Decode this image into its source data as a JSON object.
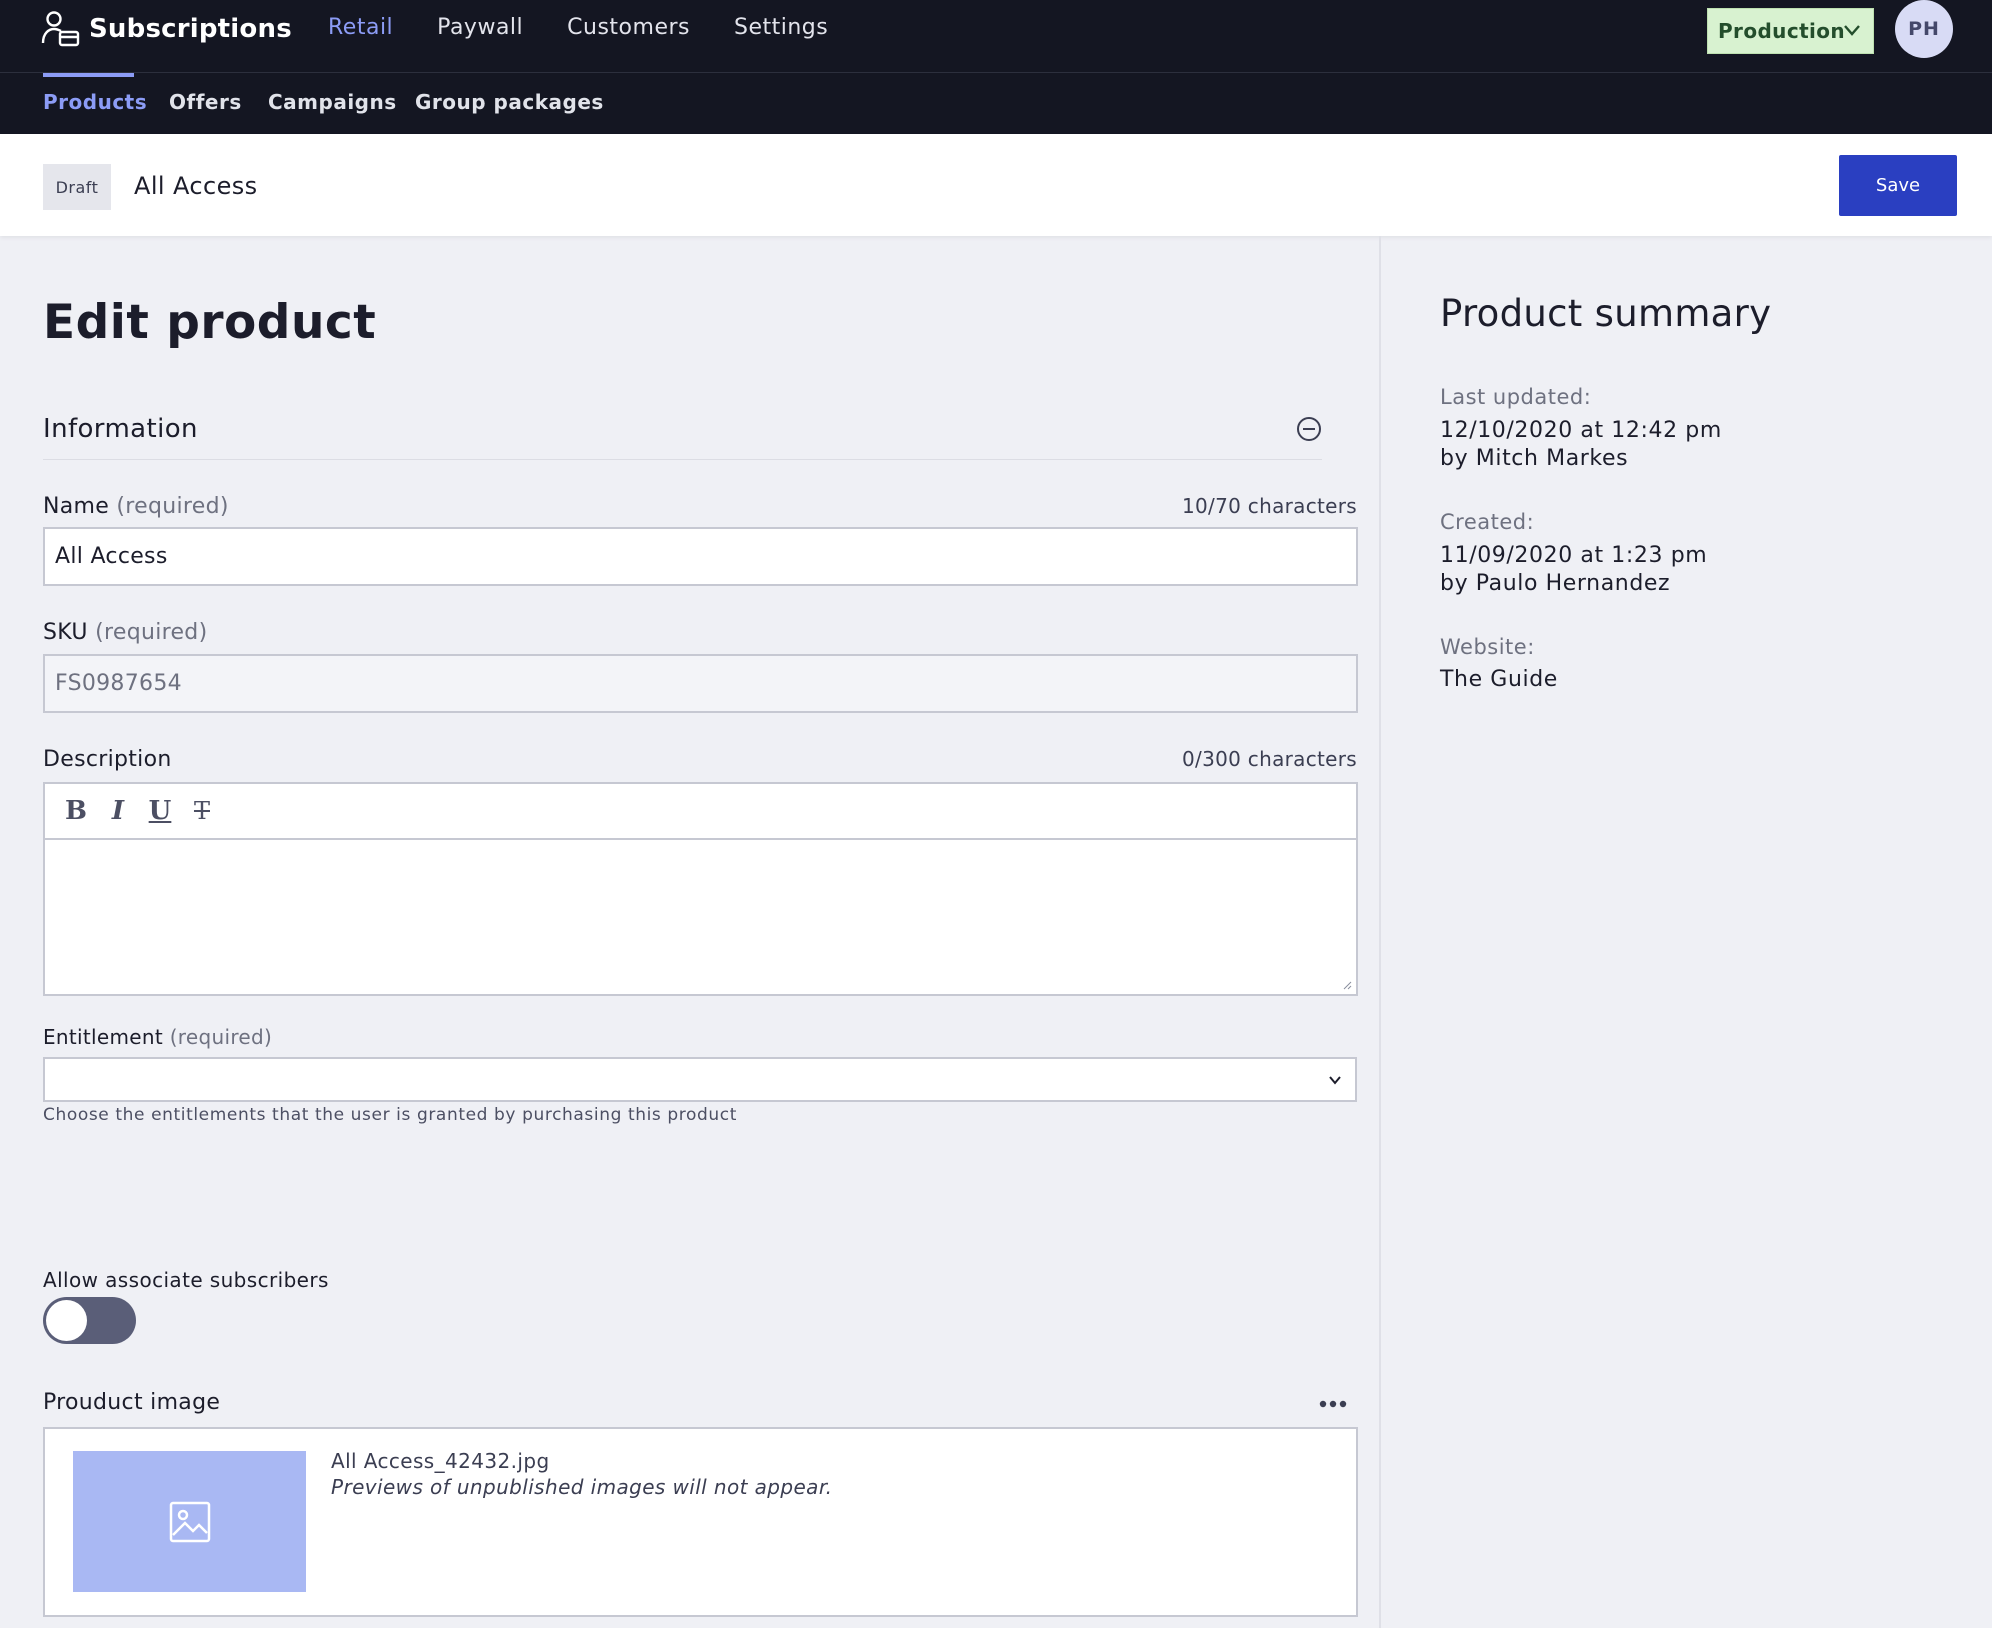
{
  "app": {
    "name": "Subscriptions",
    "icon": "user-card-icon"
  },
  "topnav": {
    "items": [
      {
        "label": "Retail",
        "active": true
      },
      {
        "label": "Paywall",
        "active": false
      },
      {
        "label": "Customers",
        "active": false
      },
      {
        "label": "Settings",
        "active": false
      }
    ]
  },
  "environment": {
    "label": "Production",
    "color": "#d8f2d0"
  },
  "user": {
    "initials": "PH"
  },
  "subnav": {
    "items": [
      {
        "label": "Products",
        "active": true
      },
      {
        "label": "Offers",
        "active": false
      },
      {
        "label": "Campaigns",
        "active": false
      },
      {
        "label": "Group packages",
        "active": false
      }
    ]
  },
  "header": {
    "status_badge": "Draft",
    "title": "All Access",
    "save_label": "Save"
  },
  "main": {
    "page_title": "Edit product",
    "section_title": "Information",
    "name": {
      "label": "Name",
      "required": "(required)",
      "value": "All Access",
      "char_count": "10/70 characters"
    },
    "sku": {
      "label": "SKU",
      "required": "(required)",
      "value": "FS0987654"
    },
    "description": {
      "label": "Description",
      "char_count": "0/300 characters",
      "value": "",
      "toolbar": [
        "B",
        "I",
        "U",
        "T"
      ]
    },
    "entitlement": {
      "label": "Entitlement",
      "required": "(required)",
      "value": "",
      "helper": "Choose the entitlements that the user is granted by purchasing this product"
    },
    "associate": {
      "label": "Allow associate subscribers",
      "enabled": false
    },
    "image": {
      "title": "Prouduct image",
      "filename": "All Access_42432.jpg",
      "note": "Previews of unpublished images will not appear."
    }
  },
  "summary": {
    "title": "Product summary",
    "last_updated_label": "Last updated:",
    "last_updated_date": "12/10/2020 at 12:42 pm",
    "last_updated_by": "by Mitch Markes",
    "created_label": "Created:",
    "created_date": "11/09/2020 at 1:23 pm",
    "created_by": "by Paulo Hernandez",
    "website_label": "Website:",
    "website_value": "The Guide"
  },
  "colors": {
    "nav_bg": "#141622",
    "accent": "#8c9cf6",
    "primary_button": "#2a3fc1",
    "page_bg": "#eff0f5"
  }
}
